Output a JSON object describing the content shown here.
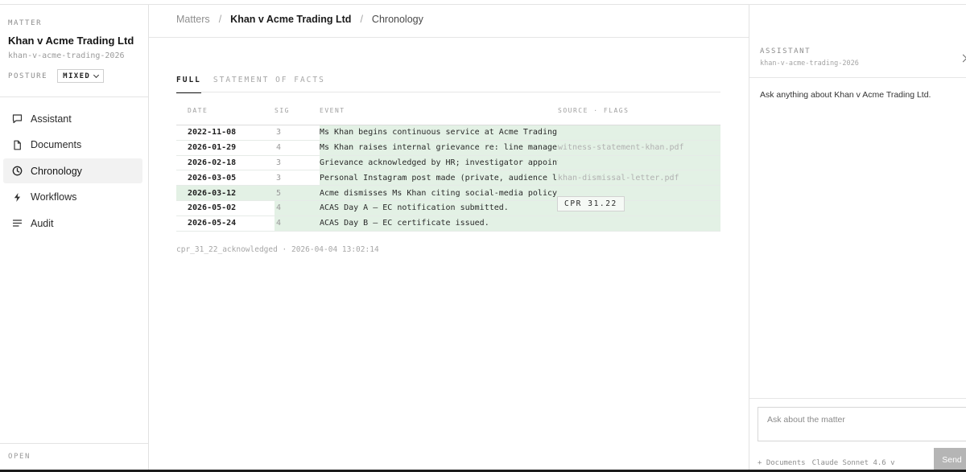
{
  "sidebar": {
    "matter_label": "MATTER",
    "matter_title": "Khan v Acme Trading Ltd",
    "matter_slug": "khan-v-acme-trading-2026",
    "posture_label": "POSTURE",
    "posture_value": "MIXED",
    "nav": [
      {
        "label": "Assistant",
        "icon": "chat-bubble-icon",
        "active": false
      },
      {
        "label": "Documents",
        "icon": "document-icon",
        "active": false
      },
      {
        "label": "Chronology",
        "icon": "clock-icon",
        "active": true
      },
      {
        "label": "Workflows",
        "icon": "lightning-icon",
        "active": false
      },
      {
        "label": "Audit",
        "icon": "list-icon",
        "active": false
      }
    ],
    "open_label": "OPEN"
  },
  "breadcrumb": {
    "root": "Matters",
    "matter": "Khan v Acme Trading Ltd",
    "page": "Chronology",
    "separator": "/"
  },
  "tabs": [
    {
      "label": "FULL",
      "active": true
    },
    {
      "label": "STATEMENT OF FACTS",
      "active": false
    }
  ],
  "table": {
    "headers": {
      "date": "DATE",
      "sig": "SIG",
      "event": "EVENT",
      "source": "SOURCE · FLAGS"
    },
    "rows": [
      {
        "date": "2022-11-08",
        "sig": "3",
        "event": "Ms Khan begins continuous service at Acme Trading Ltd.",
        "source": ""
      },
      {
        "date": "2026-01-29",
        "sig": "4",
        "event": "Ms Khan raises internal grievance re: line manager conduct.",
        "source": "witness-statement-khan.pdf"
      },
      {
        "date": "2026-02-18",
        "sig": "3",
        "event": "Grievance acknowledged by HR; investigator appointed.",
        "source": ""
      },
      {
        "date": "2026-03-05",
        "sig": "3",
        "event": "Personal Instagram post made (private, audience limited).",
        "source": "khan-dismissal-letter.pdf"
      },
      {
        "date": "2026-03-12",
        "sig": "5",
        "event": "Acme dismisses Ms Khan citing social-media policy breach.",
        "source": ""
      },
      {
        "date": "2026-05-02",
        "sig": "4",
        "event": "ACAS Day A — EC notification submitted.",
        "source": ""
      },
      {
        "date": "2026-05-24",
        "sig": "4",
        "event": "ACAS Day B — EC certificate issued.",
        "source": ""
      }
    ],
    "flag_badge": "CPR 31.22"
  },
  "ack_line": "cpr_31_22_acknowledged · 2026-04-04 13:02:14",
  "assistant": {
    "label": "ASSISTANT",
    "slug": "khan-v-acme-trading-2026",
    "prompt": "Ask anything about Khan v Acme Trading Ltd.",
    "input_placeholder": "Ask about the matter",
    "docs_label": "+ Documents",
    "model_label": "Claude Sonnet 4.6 v",
    "send_label": "Send"
  },
  "colors": {
    "highlight_green": "#e3f1e5",
    "accent_text": "#1a1a1a",
    "send_button": "#b5b5b5"
  }
}
